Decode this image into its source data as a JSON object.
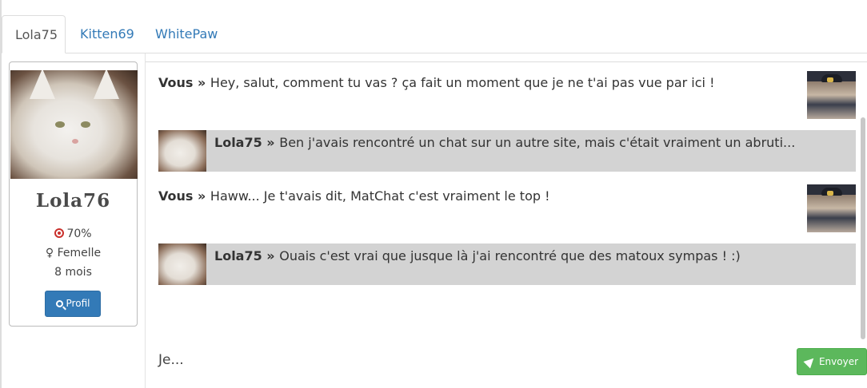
{
  "tabs": [
    {
      "label": "Lola75",
      "active": true
    },
    {
      "label": "Kitten69",
      "active": false
    },
    {
      "label": "WhitePaw",
      "active": false
    }
  ],
  "profile": {
    "name": "Lola76",
    "match": "70%",
    "gender": "Femelle",
    "age": "8 mois",
    "button_label": "Profil",
    "icons": {
      "match": "target-icon",
      "gender": "female-icon",
      "button": "search-icon"
    }
  },
  "messages": [
    {
      "sender": "Vous",
      "separator": " » ",
      "text": "Hey, salut, comment tu vas ? ça fait un moment que je ne t'ai pas vue par ici !",
      "from_me": true
    },
    {
      "sender": "Lola75",
      "separator": " » ",
      "text": "Ben j'avais rencontré un chat sur un autre site, mais c'était vraiment un abruti...",
      "from_me": false
    },
    {
      "sender": "Vous",
      "separator": " » ",
      "text": "Haww... Je t'avais dit, MatChat c'est vraiment le top !",
      "from_me": true
    },
    {
      "sender": "Lola75",
      "separator": " » ",
      "text": "Ouais c'est vrai que jusque là j'ai rencontré que des matoux sympas ! :)",
      "from_me": false
    }
  ],
  "composer": {
    "input_value": "Je...",
    "send_label": "Envoyer",
    "send_icon": "paper-plane-icon"
  },
  "colors": {
    "tab_link": "#337ab7",
    "profile_button": "#337ab7",
    "send_button": "#5cb85c",
    "incoming_message_bg": "#d3d3d3",
    "match_icon": "#c9302c"
  }
}
